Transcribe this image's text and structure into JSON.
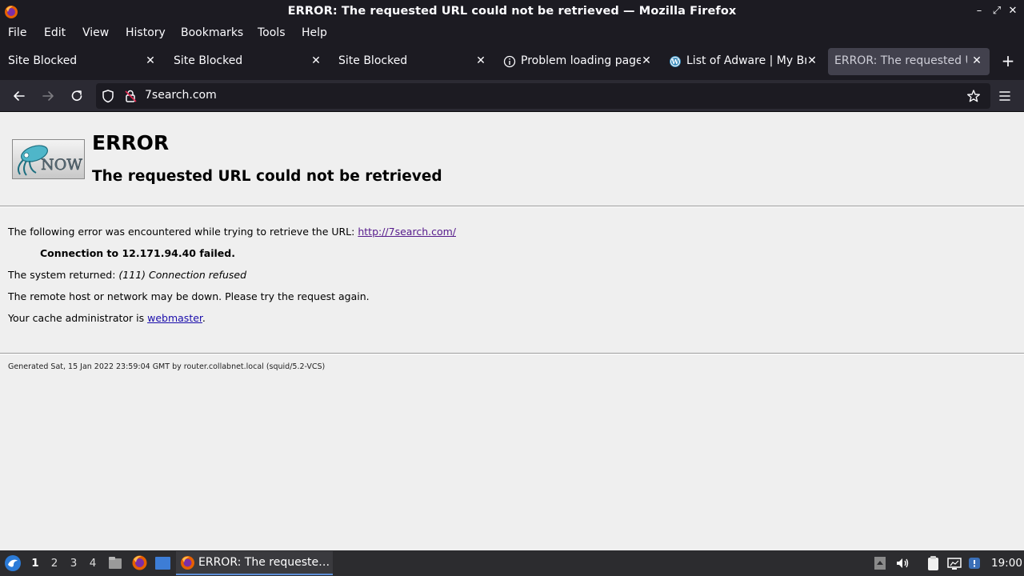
{
  "window": {
    "title": "ERROR: The requested URL could not be retrieved — Mozilla Firefox"
  },
  "menu": {
    "items": [
      "File",
      "Edit",
      "View",
      "History",
      "Bookmarks",
      "Tools",
      "Help"
    ]
  },
  "tabs": [
    {
      "label": "Site Blocked",
      "icon": null
    },
    {
      "label": "Site Blocked",
      "icon": null
    },
    {
      "label": "Site Blocked",
      "icon": null
    },
    {
      "label": "Problem loading page",
      "icon": "info-icon"
    },
    {
      "label": "List of Adware | My Bro",
      "icon": "wordpress-icon"
    },
    {
      "label": "ERROR: The requested UR",
      "icon": null,
      "active": true
    }
  ],
  "navbar": {
    "url": "7search.com"
  },
  "page": {
    "heading": "ERROR",
    "subheading": "The requested URL could not be retrieved",
    "line1_prefix": "The following error was encountered while trying to retrieve the URL: ",
    "line1_link": "http://7search.com/",
    "line2": "Connection to 12.171.94.40 failed.",
    "line3_prefix": "The system returned: ",
    "line3_em": "(111) Connection refused",
    "line4": "The remote host or network may be down. Please try the request again.",
    "line5_prefix": "Your cache administrator is ",
    "line5_link": "webmaster",
    "line5_suffix": ".",
    "footer": "Generated Sat, 15 Jan 2022 23:59:04 GMT by router.collabnet.local (squid/5.2-VCS)"
  },
  "taskbar": {
    "workspaces": [
      "1",
      "2",
      "3",
      "4"
    ],
    "task_label": "ERROR: The requeste…",
    "clock": "19:00"
  },
  "colors": {
    "chrome_dark": "#1c1b22",
    "toolbar": "#2b2a33",
    "active_tab": "#42414d",
    "page_bg": "#efefef",
    "link": "#1a0dab"
  }
}
